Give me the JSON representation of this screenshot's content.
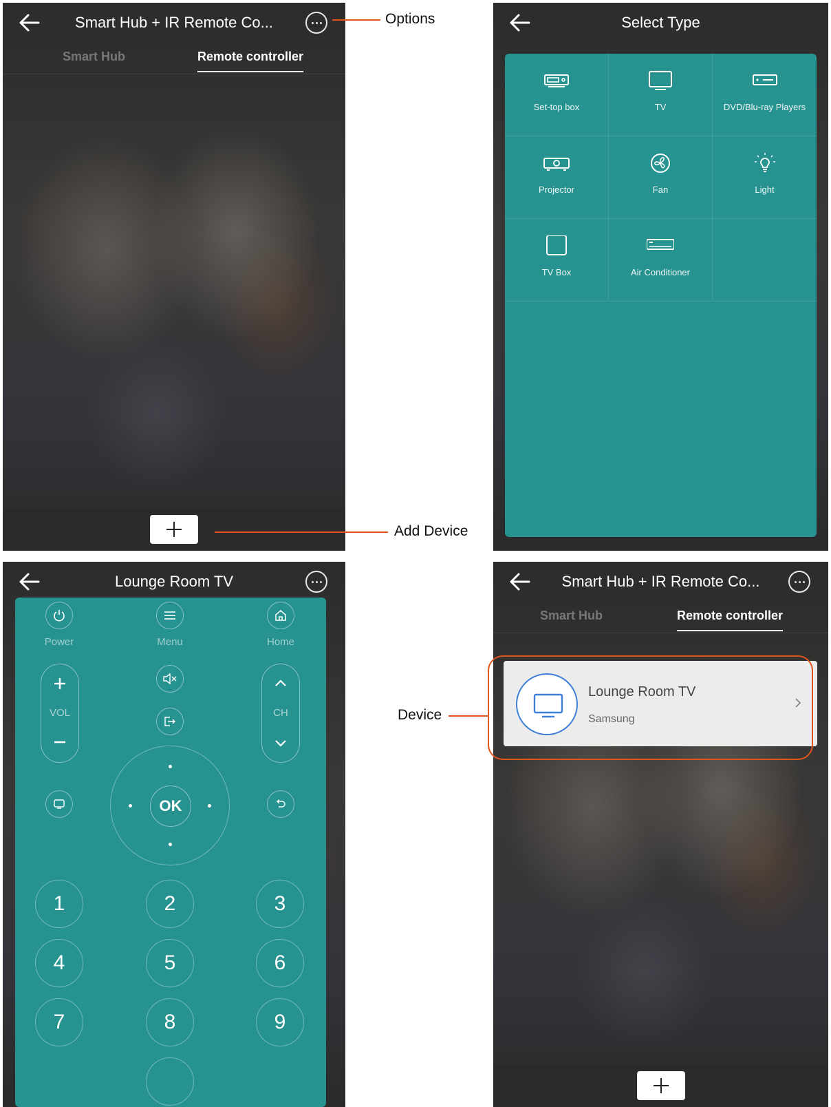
{
  "screen1": {
    "title": "Smart Hub + IR Remote Co...",
    "tabs": [
      {
        "label": "Smart Hub"
      },
      {
        "label": "Remote controller"
      }
    ]
  },
  "screen2": {
    "title": "Select Type",
    "types": [
      {
        "label": "Set-top box",
        "icon": "set-top-box-icon"
      },
      {
        "label": "TV",
        "icon": "tv-icon"
      },
      {
        "label": "DVD/Blu-ray Players",
        "icon": "dvd-player-icon"
      },
      {
        "label": "Projector",
        "icon": "projector-icon"
      },
      {
        "label": "Fan",
        "icon": "fan-icon"
      },
      {
        "label": "Light",
        "icon": "light-bulb-icon"
      },
      {
        "label": "TV Box",
        "icon": "tv-box-icon"
      },
      {
        "label": "Air Conditioner",
        "icon": "air-conditioner-icon"
      }
    ]
  },
  "screen3": {
    "title": "Lounge Room TV",
    "labels": {
      "power": "Power",
      "menu": "Menu",
      "home": "Home",
      "vol": "VOL",
      "ch": "CH",
      "ok": "OK"
    },
    "numbers": [
      "1",
      "2",
      "3",
      "4",
      "5",
      "6",
      "7",
      "8",
      "9"
    ]
  },
  "screen4": {
    "title": "Smart Hub + IR Remote Co...",
    "tabs": [
      {
        "label": "Smart Hub"
      },
      {
        "label": "Remote controller"
      }
    ],
    "device": {
      "name": "Lounge Room TV",
      "brand": "Samsung"
    }
  },
  "callouts": {
    "options": "Options",
    "add_device": "Add Device",
    "device": "Device"
  },
  "colors": {
    "panel": "#269390",
    "callout": "#e0551c",
    "device_ring": "#3f7fd6"
  }
}
